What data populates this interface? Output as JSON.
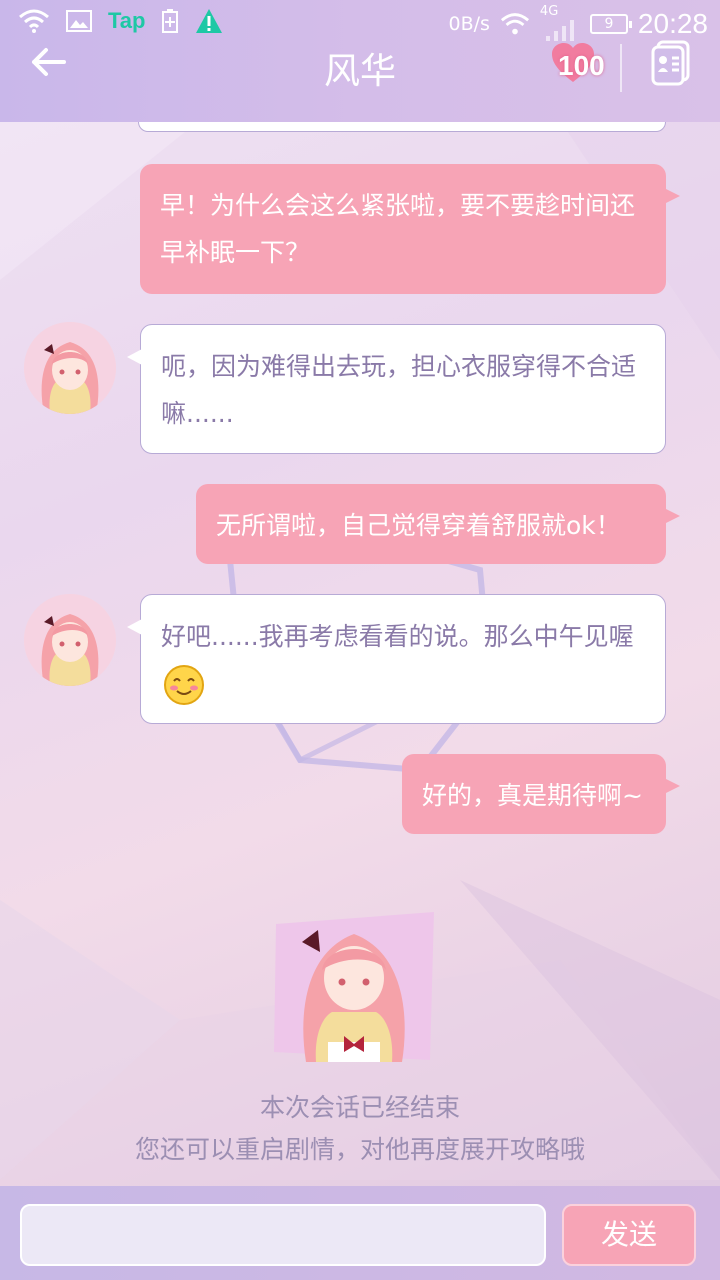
{
  "status_bar": {
    "tap_label": "Tap",
    "net_speed": "0B/s",
    "network_type": "4G",
    "battery_level": "9",
    "time": "20:28"
  },
  "header": {
    "title": "风华",
    "affection": "100"
  },
  "messages": [
    {
      "side": "out",
      "text": "早！为什么会这么紧张啦，要不要趁时间还早补眠一下？"
    },
    {
      "side": "in",
      "text": "呃，因为难得出去玩，担心衣服穿得不合适嘛......"
    },
    {
      "side": "out",
      "text": "无所谓啦，自己觉得穿着舒服就ok！"
    },
    {
      "side": "in",
      "text": "好吧......我再考虑看看的说。那么中午见喔",
      "emoji": "smile-emoji"
    },
    {
      "side": "out",
      "text": "好的，真是期待啊~"
    }
  ],
  "end_notice": {
    "line1": "本次会话已经结束",
    "line2": "您还可以重启剧情，对他再度展开攻略哦"
  },
  "composer": {
    "input_value": "",
    "send_label": "发送"
  },
  "colors": {
    "accent_pink": "#f7a4b6",
    "header_purple": "#c9b7ea",
    "incoming_text": "#8a7aa8"
  }
}
